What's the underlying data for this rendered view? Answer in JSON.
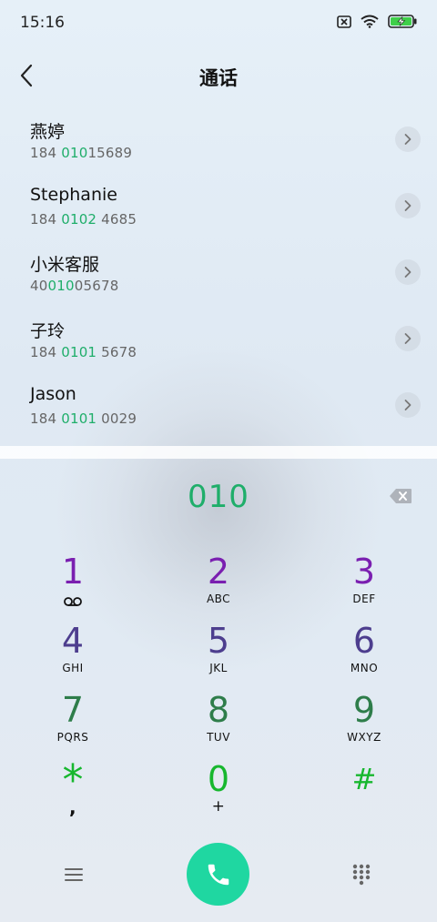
{
  "status_bar": {
    "time": "15:16",
    "icons": [
      "no-sim-icon",
      "wifi-icon",
      "battery-charging-icon"
    ]
  },
  "header": {
    "title": "通话",
    "back_icon": "chevron-left-icon"
  },
  "contacts": [
    {
      "name": "燕婷",
      "number_pre": "184 ",
      "number_match": "010",
      "number_post": "15689"
    },
    {
      "name": "Stephanie",
      "number_pre": "184 ",
      "number_match": "0102",
      "number_post": " 4685"
    },
    {
      "name": "小米客服",
      "number_pre": "40",
      "number_match": "010",
      "number_post": "05678"
    },
    {
      "name": "子玲",
      "number_pre": "184 ",
      "number_match": "0101",
      "number_post": " 5678"
    },
    {
      "name": "Jason",
      "number_pre": "184 ",
      "number_match": "0101",
      "number_post": " 0029"
    }
  ],
  "dialer": {
    "number": "010",
    "backspace_icon": "backspace-icon"
  },
  "keypad": [
    {
      "digit": "1",
      "letters": "",
      "color": "#7a1fb0",
      "sub_icon": "voicemail-icon"
    },
    {
      "digit": "2",
      "letters": "ABC",
      "color": "#7a1fb0"
    },
    {
      "digit": "3",
      "letters": "DEF",
      "color": "#7a1fb0"
    },
    {
      "digit": "4",
      "letters": "GHI",
      "color": "#4d3e8e"
    },
    {
      "digit": "5",
      "letters": "JKL",
      "color": "#4d3e8e"
    },
    {
      "digit": "6",
      "letters": "MNO",
      "color": "#4d3e8e"
    },
    {
      "digit": "7",
      "letters": "PQRS",
      "color": "#2e7d4a"
    },
    {
      "digit": "8",
      "letters": "TUV",
      "color": "#2e7d4a"
    },
    {
      "digit": "9",
      "letters": "WXYZ",
      "color": "#2e7d4a"
    },
    {
      "digit": "*",
      "letters": ",",
      "color": "#17b72e"
    },
    {
      "digit": "0",
      "letters": "+",
      "color": "#17b72e"
    },
    {
      "digit": "#",
      "letters": "",
      "color": "#17b72e"
    }
  ],
  "bottom_bar": {
    "menu_icon": "menu-icon",
    "call_icon": "phone-icon",
    "dialpad_icon": "dialpad-icon",
    "call_color": "#1fd7a1"
  }
}
